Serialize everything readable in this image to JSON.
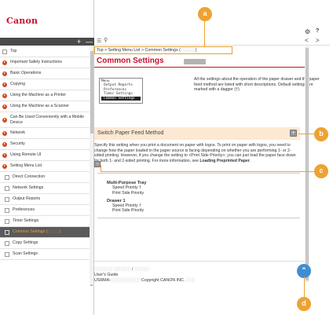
{
  "brand": {
    "logo_text": "Canon",
    "color": "#c8102e"
  },
  "sidebar": {
    "toolbar": {
      "expand_label": "+",
      "collapse_label": "—"
    },
    "items": [
      {
        "label": "Top",
        "icon": "page-icon"
      },
      {
        "label": "Important Safety Instructions",
        "icon": "chapter-icon"
      },
      {
        "label": "Basic Operations",
        "icon": "chapter-icon"
      },
      {
        "label": "Copying",
        "icon": "chapter-icon"
      },
      {
        "label": "Using the Machine as a Printer",
        "icon": "chapter-icon"
      },
      {
        "label": "Using the Machine as a Scanner",
        "icon": "chapter-icon"
      },
      {
        "label": "Can Be Used Conveniently with a Mobile Device",
        "icon": "chapter-icon"
      },
      {
        "label": "Network",
        "icon": "chapter-icon"
      },
      {
        "label": "Security",
        "icon": "chapter-icon"
      },
      {
        "label": "Using Remote UI",
        "icon": "chapter-icon"
      },
      {
        "label": "Setting Menu List",
        "icon": "chapter-icon"
      },
      {
        "label": "Direct Connection",
        "icon": "page-icon"
      },
      {
        "label": "Network Settings",
        "icon": "page-icon"
      },
      {
        "label": "Output Reports",
        "icon": "page-icon"
      },
      {
        "label": "Preferences",
        "icon": "page-icon"
      },
      {
        "label": "Timer Settings",
        "icon": "page-icon"
      },
      {
        "label": "Common Settings (",
        "label_tail": ")",
        "icon": "page-icon"
      },
      {
        "label": "Copy Settings",
        "icon": "page-icon"
      },
      {
        "label": "Scan Settings",
        "icon": "page-icon"
      }
    ]
  },
  "header": {
    "gear_icon": "gear-icon",
    "help_label": "?",
    "prev_label": "<",
    "next_label": ">"
  },
  "breadcrumb": {
    "text": "Top > Setting Menu List > Common Settings (",
    "tail": ")"
  },
  "page": {
    "title": "Common Settings",
    "menu_box": {
      "heading": "Menu",
      "items": [
        "Output Reports",
        "Preferences",
        "Timer Settings",
        "Common Settings"
      ],
      "selected_index": 3
    },
    "intro": "All the settings about the operation of the paper drawer and the paper feed method are listed with short descriptions. Default settings are marked with a dagger (†).",
    "section_title": "Switch Paper Feed Method",
    "section_toggle": "+",
    "paragraph": "Specify this setting when you print a document on paper with logos. To print on paper with logos, you need to change how the paper loaded in the paper source is facing depending on whether you are performing 1- or 2-sided printing. However, if you change the setting to <Print Side Priority>, you can just load the paper face down for both 1- and 2-sided printing. For more information, see",
    "paragraph_link": "Loading Preprinted Paper",
    "paragraph_end": ".",
    "small_toggle": "−",
    "settings": [
      {
        "group": "Multi-Purpose Tray",
        "items": [
          "Speed Priority †",
          "Print Side Priority"
        ]
      },
      {
        "group": "Drawer 1",
        "items": [
          "Speed Priority †",
          "Print Side Priority"
        ]
      }
    ]
  },
  "footer": {
    "line1_tail": "/",
    "guide": "User's Guide",
    "code": "USRMA-",
    "copyright": "Copyright CANON INC."
  },
  "page_top_label": "⌃",
  "callouts": {
    "a": "a",
    "b": "b",
    "c": "c",
    "d": "d"
  },
  "colors": {
    "accent_orange": "#eea233",
    "section_bg": "#fde8d3",
    "page_top_blue": "#3f8ed2"
  }
}
